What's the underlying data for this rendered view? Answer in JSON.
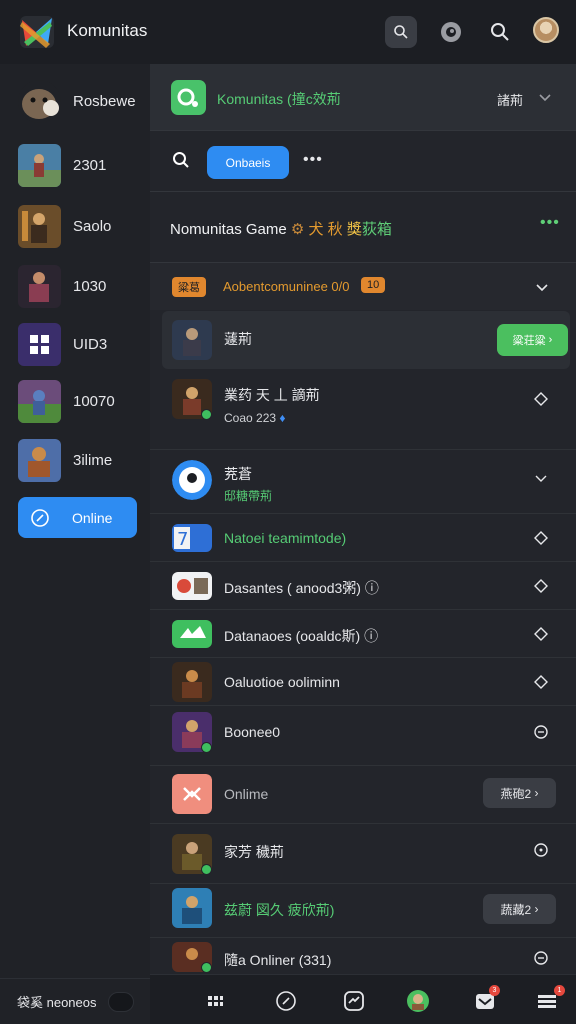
{
  "app": {
    "title": "Komunitas"
  },
  "topbar": {
    "icons": [
      "search-icon",
      "disc-icon",
      "search-icon",
      "avatar"
    ]
  },
  "sidebar": {
    "items": [
      {
        "label": "Rosbewe",
        "icon": "creature-avatar"
      },
      {
        "label": "2301",
        "icon": "game-thumb"
      },
      {
        "label": "Saolo",
        "icon": "game-thumb"
      },
      {
        "label": "1030",
        "icon": "game-thumb"
      },
      {
        "label": "UID3",
        "icon": "grid-icon"
      },
      {
        "label": "10070",
        "icon": "game-thumb"
      },
      {
        "label": "3ilime",
        "icon": "game-thumb"
      }
    ],
    "online_button": "Online",
    "footer_label": "袋奚 neoneos"
  },
  "main": {
    "header": {
      "title": "Komunitas (撞c效荊",
      "right_label": "諸荊"
    },
    "search": {
      "pill_label": "Onbaeis"
    },
    "game_title": {
      "prefix": "Nomunitas Game",
      "g1": "犬 秋",
      "g2": "獎",
      "g3": "荻箱"
    },
    "subheader": {
      "badge1": "粱葛",
      "text": "Aobentcomuninee 0/0",
      "badge2": "10"
    },
    "rows": [
      {
        "label": "蘧荊",
        "button": "粱荘粱"
      },
      {
        "label": "業药 天 丄 謫荊",
        "sub": "Coao 223"
      },
      {
        "label": "茺蒼",
        "sub": "邸糖帶荊"
      },
      {
        "label": "Natoei teamimtode)",
        "thumb_text": "7"
      },
      {
        "label": "Dasantes ( anood3粥)"
      },
      {
        "label": "Datanaoes (ooaldc斯)"
      },
      {
        "label": "Oaluotioe ooliminn"
      },
      {
        "label": "Boonee0"
      },
      {
        "label": "Onlime",
        "button": "燕砲2"
      },
      {
        "label": "家芳 穢荊"
      },
      {
        "label": "兹蔚 図久 疲欣荊)",
        "button": "蔬藏2"
      },
      {
        "label": "隨a Onliner (331)"
      }
    ]
  },
  "bottomnav": {
    "items": [
      "grid-icon",
      "compass-icon",
      "link-icon",
      "profile-avatar",
      "inbox-icon",
      "menu-icon"
    ],
    "badge1": "3",
    "badge2": "1"
  },
  "colors": {
    "accent_blue": "#2e8cf2",
    "accent_green": "#4bbf5f",
    "accent_orange": "#e0872e",
    "bg": "#1b1d22"
  }
}
